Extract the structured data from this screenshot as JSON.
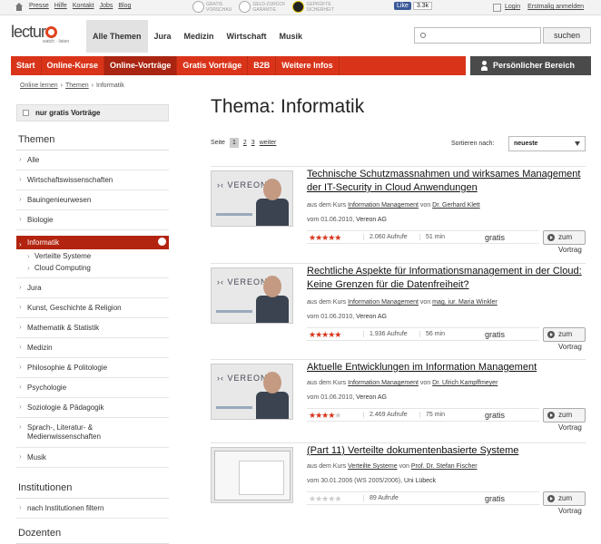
{
  "topbar": {
    "links": [
      "Presse",
      "Hilfe",
      "Kontakt",
      "Jobs",
      "Blog"
    ],
    "badges": [
      {
        "line1": "GRATIS",
        "line2": "VORSCHAU"
      },
      {
        "line1": "GELD-ZURÜCK",
        "line2": "GARANTIE"
      },
      {
        "line1": "GEPRÜFTE",
        "line2": "SICHERHEIT"
      }
    ],
    "like_label": "Like",
    "like_count": "3.3k",
    "login": "Login",
    "register": "Erstmalig anmelden"
  },
  "header": {
    "logo_a": "lectur",
    "logo_b": "",
    "logo_sub": "watch · listen",
    "nav": [
      "Alle Themen",
      "Jura",
      "Medizin",
      "Wirtschaft",
      "Musik"
    ],
    "search_placeholder": "",
    "search_button": "suchen"
  },
  "subnav": {
    "items": [
      "Start",
      "Online-Kurse",
      "Online-Vorträge",
      "Gratis Vorträge",
      "B2B",
      "Weitere Infos"
    ],
    "personal": "Persönlicher Bereich"
  },
  "breadcrumb": [
    "Online lernen",
    "Themen",
    "Informatik"
  ],
  "sidebar": {
    "gratis": "nur gratis Vorträge",
    "themen_heading": "Themen",
    "items": [
      "Alle",
      "Wirtschaftswissenschaften",
      "Bauingenieurwesen",
      "Biologie"
    ],
    "active": "Informatik",
    "subitems": [
      "Verteilte Systeme",
      "Cloud Computing"
    ],
    "items_after": [
      "Jura",
      "Kunst, Geschichte & Religion",
      "Mathematik & Statistik",
      "Medizin",
      "Philosophie & Politologie",
      "Psychologie",
      "Soziologie & Pädagogik"
    ],
    "sprach_line1": "Sprach-, Literatur- &",
    "sprach_line2": "Medienwissenschaften",
    "musik": "Musik",
    "inst_heading": "Institutionen",
    "inst_item": "nach Institutionen filtern",
    "dozenten_heading": "Dozenten"
  },
  "main": {
    "title": "Thema: Informatik",
    "pager_label": "Seite",
    "pages": [
      "1",
      "2",
      "3"
    ],
    "next": "weiter",
    "sort_label": "Sortieren nach:",
    "sort_value": "neueste",
    "free_label": "gratis",
    "button_label": "zum Vortrag",
    "meta_prefix": "aus dem Kurs",
    "meta_by": "von",
    "date_prefix": "vom",
    "views_suffix": "Aufrufe",
    "items": [
      {
        "title": "Technische Schutzmassnahmen und wirksames Management der IT-Security in Cloud Anwendungen",
        "course": "Information Management",
        "author": "Dr. Gerhard Klett",
        "date": "01.06.2010",
        "org": "Vereon AG",
        "rating": 5,
        "views": "2.060",
        "duration": "51 min",
        "thumb": "vereon"
      },
      {
        "title": "Rechtliche Aspekte für Informationsmanagement in der Cloud: Keine Grenzen für die Datenfreiheit?",
        "course": "Information Management",
        "author": "mag. iur. Maria Winkler",
        "date": "01.06.2010",
        "org": "Vereon AG",
        "rating": 5,
        "views": "1.936",
        "duration": "56 min",
        "thumb": "vereon"
      },
      {
        "title": "Aktuelle Entwicklungen im Information Management",
        "course": "Information Management",
        "author": "Dr. Ulrich Kampffmeyer",
        "date": "01.06.2010",
        "org": "Vereon AG",
        "rating": 4.5,
        "views": "2.469",
        "duration": "75 min",
        "thumb": "vereon"
      },
      {
        "title": "(Part 11) Verteilte dokumentenbasierte Systeme",
        "course": "Verteilte Systeme",
        "author": "Prof. Dr. Stefan Fischer",
        "date": "30.01.2006 (WS 2005/2006)",
        "org": "Uni Lübeck",
        "rating": 0,
        "views": "89",
        "duration": "",
        "thumb": "screen"
      }
    ]
  }
}
